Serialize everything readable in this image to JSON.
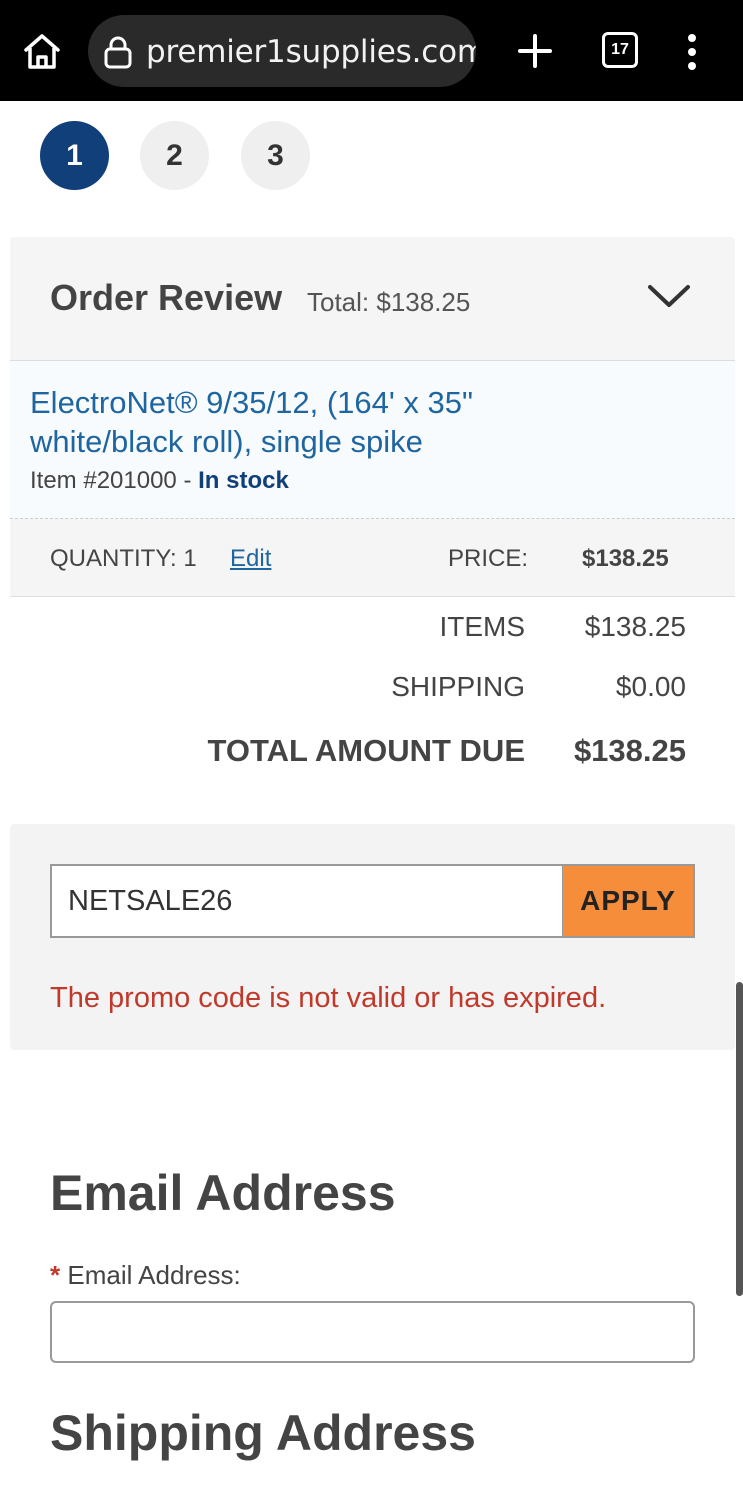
{
  "browser": {
    "url": "premier1supplies.com/",
    "tab_count": "17"
  },
  "steps": [
    "1",
    "2",
    "3"
  ],
  "order_review": {
    "title": "Order Review",
    "total_label": "Total: $138.25",
    "item": {
      "name": "ElectroNet® 9/35/12, (164' x 35\" white/black roll), single spike",
      "item_number": "Item #201000 - ",
      "stock_status": "In stock"
    },
    "quantity_label": "QUANTITY: 1",
    "edit_label": "Edit",
    "price_label": "PRICE:",
    "price_value": "$138.25"
  },
  "summary": {
    "items_label": "ITEMS",
    "items_value": "$138.25",
    "shipping_label": "SHIPPING",
    "shipping_value": "$0.00",
    "total_label": "TOTAL AMOUNT DUE",
    "total_value": "$138.25"
  },
  "promo": {
    "code_value": "NETSALE26",
    "apply_label": "APPLY",
    "error_message": "The promo code is not valid or has expired."
  },
  "email_section": {
    "title": "Email Address",
    "required_marker": "*",
    "field_label": "Email Address:",
    "field_value": ""
  },
  "shipping_section": {
    "title": "Shipping Address"
  },
  "colors": {
    "step_active": "#103f7a",
    "link": "#1f65a0",
    "apply_button": "#f68d3a",
    "error": "#c0392b"
  },
  "icons": {
    "home": "home-icon",
    "lock": "lock-icon",
    "new_tab": "plus-icon",
    "tabs": "tab-switcher-icon",
    "menu": "more-vertical-icon",
    "collapse": "chevron-down-icon"
  }
}
